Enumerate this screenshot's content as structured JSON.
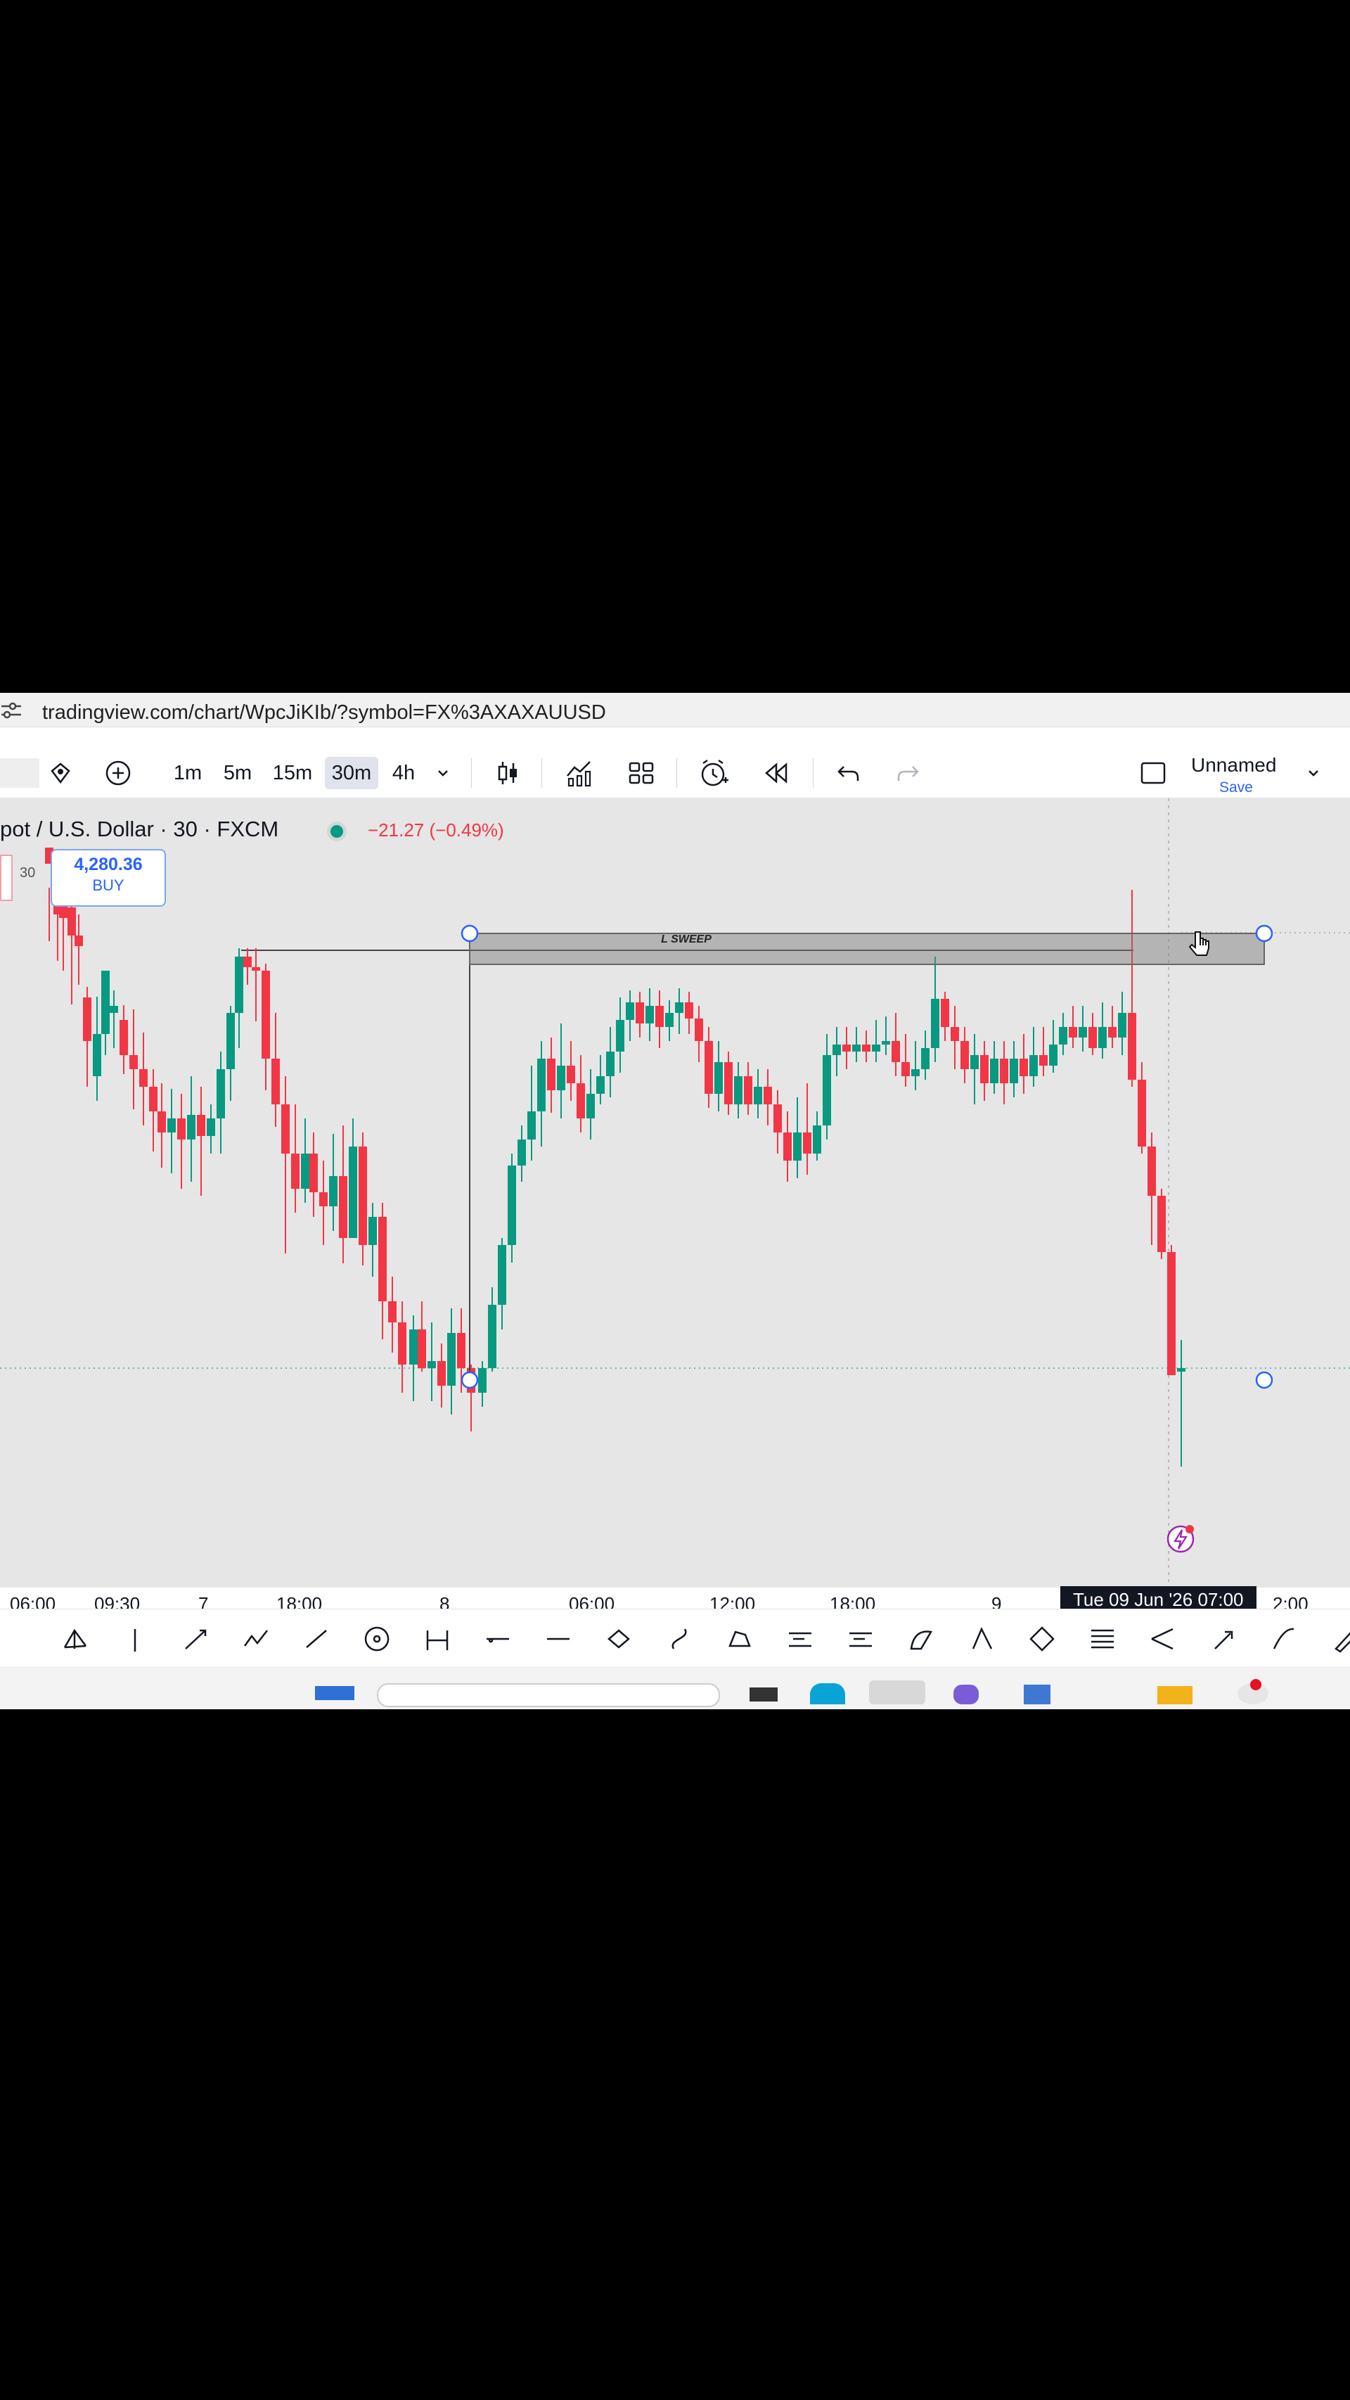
{
  "browser": {
    "url": "tradingview.com/chart/WpcJiKIb/?symbol=FX%3AXAXAUUSD"
  },
  "toolbar": {
    "intervals": [
      "1m",
      "5m",
      "15m",
      "30m",
      "4h"
    ],
    "active_interval": "30m",
    "layout_name": "Unnamed",
    "layout_save": "Save"
  },
  "symbol": {
    "title": "pot / U.S. Dollar · 30 · FXCM",
    "change": "−21.27 (−0.49%)",
    "status_color": "#089981"
  },
  "order": {
    "price": "4,280.36",
    "side": "BUY",
    "stub": "30"
  },
  "drawing": {
    "label": "L SWEEP"
  },
  "axis": {
    "ticks": [
      "06:00",
      "09:30",
      "7",
      "18:00",
      "8",
      "06:00",
      "12:00",
      "18:00",
      "9",
      "2:00"
    ],
    "crosshair_label": "Tue 09 Jun '26   07:00"
  },
  "colors": {
    "up": "#089981",
    "down": "#f23645",
    "accent": "#2962ff"
  },
  "icons": {
    "drawing_tools": [
      "rectangle-icon",
      "pitchfork-icon",
      "vertical-line-icon",
      "arrow-icon",
      "path-icon",
      "trend-line-icon",
      "circle-icon",
      "date-range-icon",
      "horizontal-ray-icon",
      "horizontal-line-icon",
      "ellipse-icon",
      "curve-icon",
      "polyline-icon",
      "long-position-icon",
      "short-position-icon",
      "arc-icon",
      "triangle-icon",
      "rotated-rectangle-icon",
      "parallel-channel-icon",
      "fan-icon",
      "arrow-marker-icon",
      "brush-icon",
      "highlighter-icon"
    ]
  }
}
